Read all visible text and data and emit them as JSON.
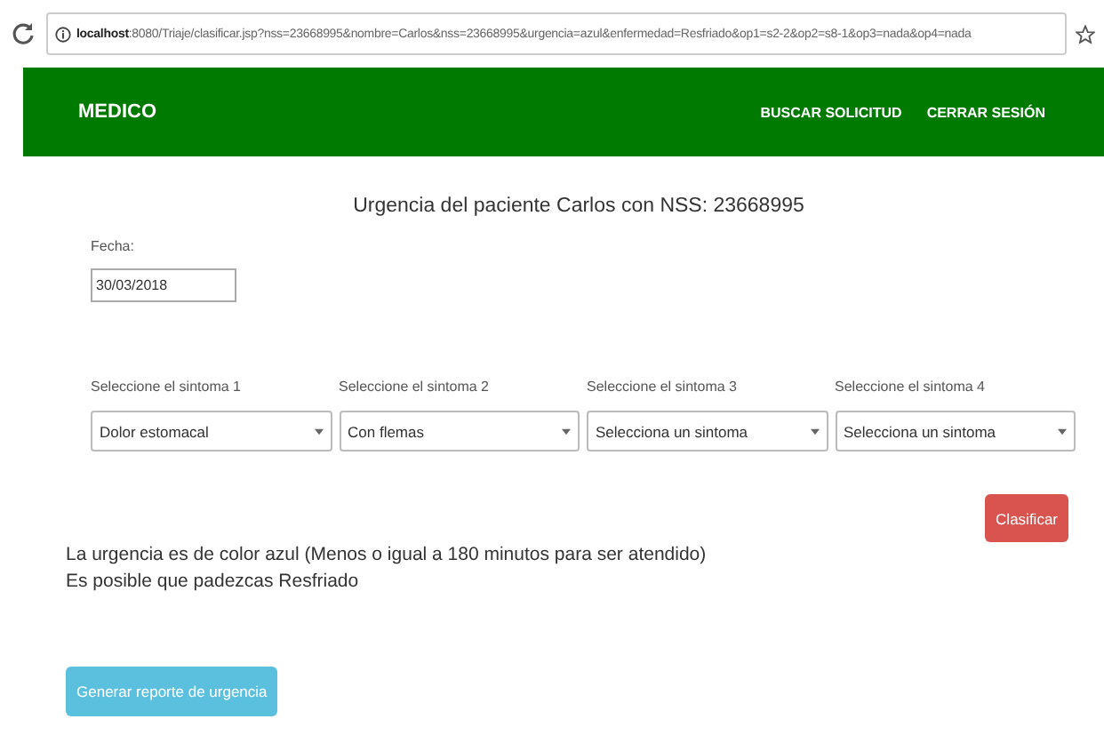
{
  "browser": {
    "url_host": "localhost",
    "url_rest": ":8080/Triaje/clasificar.jsp?nss=23668995&nombre=Carlos&nss=23668995&urgencia=azul&enfermedad=Resfriado&op1=s2-2&op2=s8-1&op3=nada&op4=nada"
  },
  "navbar": {
    "brand": "MEDICO",
    "links": [
      "BUSCAR SOLICITUD",
      "CERRAR SESIÓN"
    ]
  },
  "title": "Urgencia del paciente Carlos con NSS: 23668995",
  "date_field": {
    "label": "Fecha:",
    "value": "30/03/2018"
  },
  "symptoms": [
    {
      "label": "Seleccione el sintoma 1",
      "value": "Dolor estomacal"
    },
    {
      "label": "Seleccione el sintoma 2",
      "value": "Con flemas"
    },
    {
      "label": "Seleccione el sintoma 3",
      "value": "Selecciona un sintoma"
    },
    {
      "label": "Seleccione el sintoma 4",
      "value": "Selecciona un sintoma"
    }
  ],
  "classify_button": "Clasificar",
  "results": [
    "La urgencia es de color azul (Menos o igual a 180 minutos para ser atendido)",
    "Es posible que padezcas Resfriado"
  ],
  "report_button": "Generar reporte de urgencia"
}
